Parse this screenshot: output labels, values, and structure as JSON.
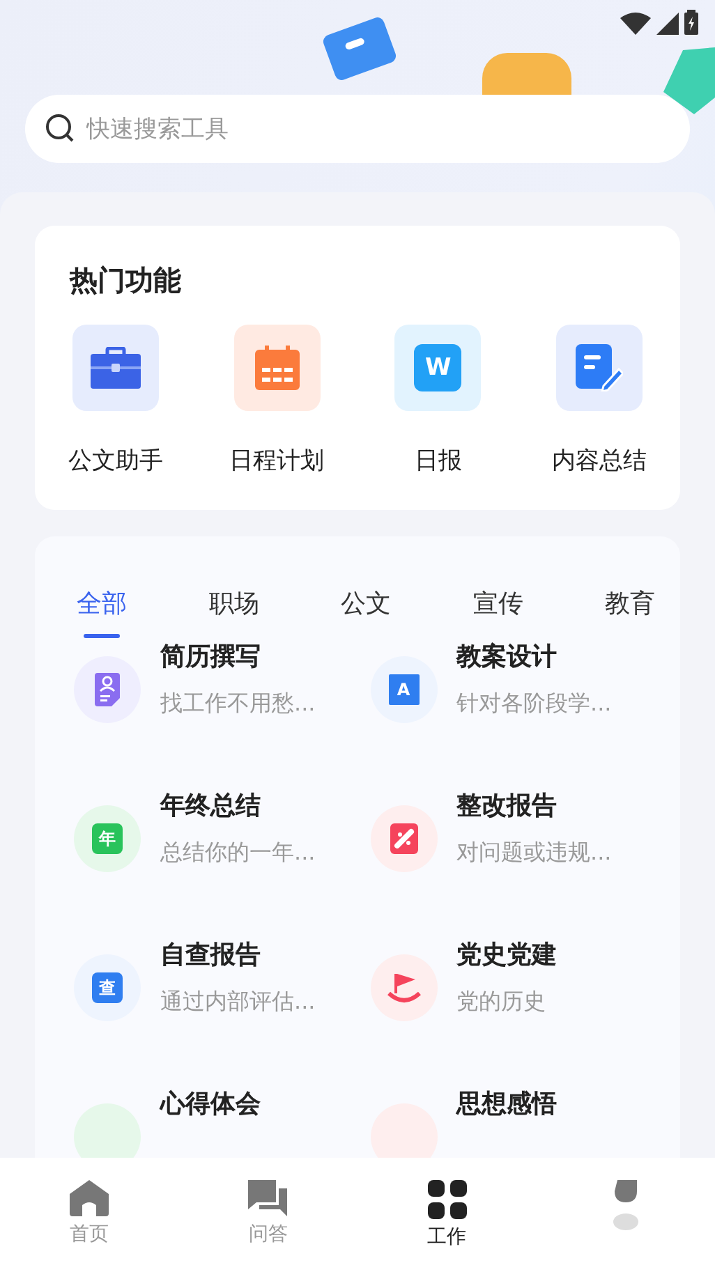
{
  "search": {
    "placeholder": "快速搜索工具"
  },
  "hot": {
    "title": "热门功能",
    "items": [
      {
        "label": "公文助手",
        "kind": "briefcase"
      },
      {
        "label": "日程计划",
        "kind": "calendar"
      },
      {
        "label": "日报",
        "kind": "word",
        "icon_text": "W"
      },
      {
        "label": "内容总结",
        "kind": "note"
      }
    ]
  },
  "tabs": [
    {
      "label": "全部",
      "selected": true
    },
    {
      "label": "职场",
      "selected": false
    },
    {
      "label": "公文",
      "selected": false
    },
    {
      "label": "宣传",
      "selected": false
    },
    {
      "label": "教育",
      "selected": false
    }
  ],
  "tools": [
    {
      "title": "简历撰写",
      "desc": "找工作不用愁...",
      "kind": "resume"
    },
    {
      "title": "教案设计",
      "desc": "针对各阶段学...",
      "kind": "letter",
      "icon_text": "A"
    },
    {
      "title": "年终总结",
      "desc": "总结你的一年...",
      "kind": "green",
      "icon_text": "年"
    },
    {
      "title": "整改报告",
      "desc": "对问题或违规...",
      "kind": "pill"
    },
    {
      "title": "自查报告",
      "desc": "通过内部评估...",
      "kind": "blue",
      "icon_text": "查"
    },
    {
      "title": "党史党建",
      "desc": "党的历史",
      "kind": "flag"
    },
    {
      "title": "心得体会",
      "kind": "greencut"
    },
    {
      "title": "思想感悟",
      "kind": "redcut"
    }
  ],
  "nav": [
    {
      "label": "首页",
      "kind": "home",
      "selected": false
    },
    {
      "label": "问答",
      "kind": "chat",
      "selected": false
    },
    {
      "label": "工作",
      "kind": "grid",
      "selected": true
    },
    {
      "kind": "blob",
      "selected": false
    }
  ]
}
